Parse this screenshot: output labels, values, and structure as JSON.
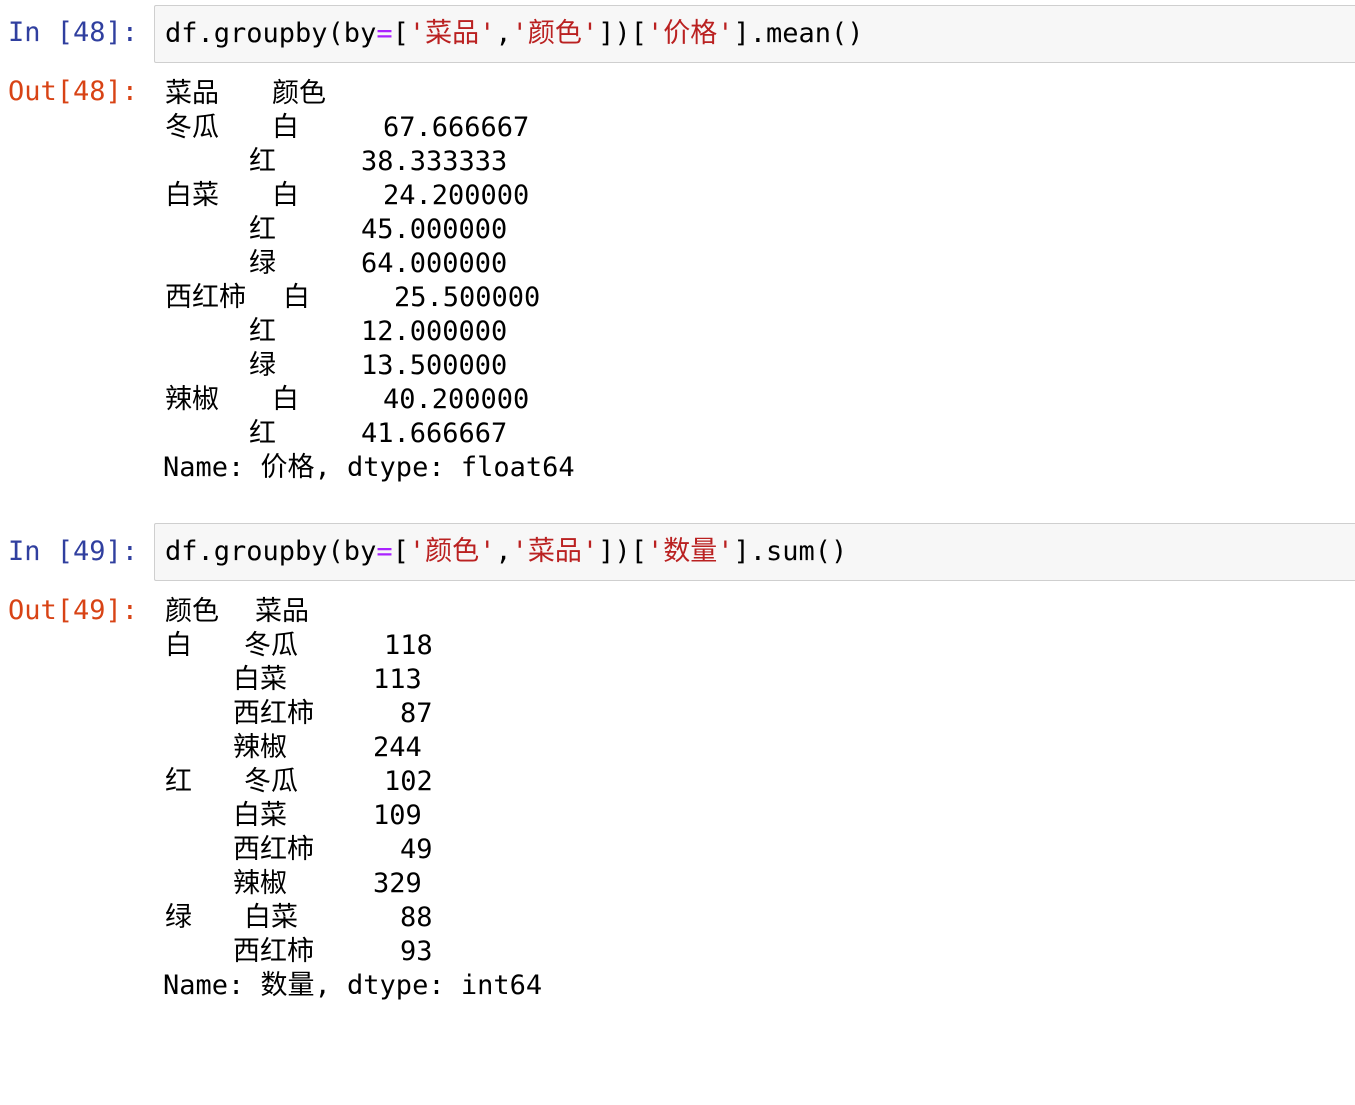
{
  "cells": [
    {
      "in_prompt": "In [48]:",
      "code": {
        "t1": "df.groupby(by",
        "eq": "=",
        "t2": "[",
        "s1": "'菜品'",
        "t3": ",",
        "s2": "'颜色'",
        "t4": "])[",
        "s3": "'价格'",
        "t5": "].mean()"
      },
      "out_prompt": "Out[48]:",
      "output": {
        "header": [
          "菜品",
          "颜色"
        ],
        "rows": [
          [
            "冬瓜",
            "白",
            "67.666667"
          ],
          [
            "",
            "红",
            "38.333333"
          ],
          [
            "白菜",
            "白",
            "24.200000"
          ],
          [
            "",
            "红",
            "45.000000"
          ],
          [
            "",
            "绿",
            "64.000000"
          ],
          [
            "西红柿",
            "白",
            "25.500000"
          ],
          [
            "",
            "红",
            "12.000000"
          ],
          [
            "",
            "绿",
            "13.500000"
          ],
          [
            "辣椒",
            "白",
            "40.200000"
          ],
          [
            "",
            "红",
            "41.666667"
          ]
        ],
        "footer": "Name: 价格, dtype: float64"
      }
    },
    {
      "in_prompt": "In [49]:",
      "code": {
        "t1": "df.groupby(by",
        "eq": "=",
        "t2": "[",
        "s1": "'颜色'",
        "t3": ",",
        "s2": "'菜品'",
        "t4": "])[",
        "s3": "'数量'",
        "t5": "].sum()"
      },
      "out_prompt": "Out[49]:",
      "output": {
        "header": [
          "颜色",
          "菜品"
        ],
        "rows": [
          [
            "白",
            "冬瓜",
            "118"
          ],
          [
            "",
            "白菜",
            "113"
          ],
          [
            "",
            "西红柿",
            "87"
          ],
          [
            "",
            "辣椒",
            "244"
          ],
          [
            "红",
            "冬瓜",
            "102"
          ],
          [
            "",
            "白菜",
            "109"
          ],
          [
            "",
            "西红柿",
            "49"
          ],
          [
            "",
            "辣椒",
            "329"
          ],
          [
            "绿",
            "白菜",
            "88"
          ],
          [
            "",
            "西红柿",
            "93"
          ]
        ],
        "footer": "Name: 数量, dtype: int64"
      }
    }
  ]
}
